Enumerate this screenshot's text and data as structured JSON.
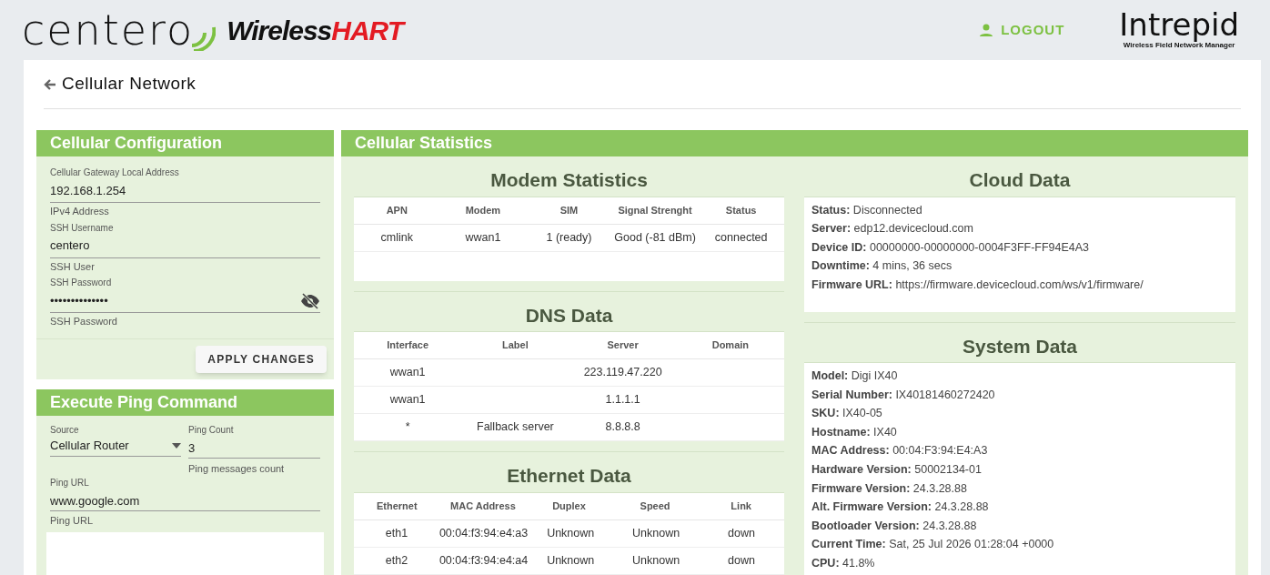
{
  "header": {
    "logo": "centero",
    "brand_left": "Wireless",
    "brand_right": "HART",
    "logout": "LOGOUT",
    "product": "Intrepid",
    "product_subtitle": "Wireless Field Network Manager"
  },
  "page": {
    "title": "Cellular Network"
  },
  "config": {
    "title": "Cellular Configuration",
    "fields": [
      {
        "kind": "text",
        "label": "Cellular Gateway Local Address",
        "value": "192.168.1.254",
        "helper": "IPv4 Address"
      },
      {
        "kind": "text",
        "label": "SSH Username",
        "value": "centero",
        "helper": "SSH User"
      },
      {
        "kind": "password",
        "label": "SSH Password",
        "value": "••••••••••••••",
        "helper": "SSH Password"
      }
    ],
    "button": "APPLY CHANGES"
  },
  "ping": {
    "title": "Execute Ping Command",
    "source": {
      "label": "Source",
      "value": "Cellular Router"
    },
    "count": {
      "label": "Ping Count",
      "value": "3",
      "helper": "Ping messages count"
    },
    "url": {
      "label": "Ping URL",
      "value": "www.google.com",
      "helper": "Ping URL"
    }
  },
  "stats": {
    "title": "Cellular Statistics",
    "tables": [
      {
        "title": "Modem Statistics",
        "columns": [
          "APN",
          "Modem",
          "SIM",
          "Signal Strenght",
          "Status"
        ],
        "rows": [
          [
            "cmlink",
            "wwan1",
            "1 (ready)",
            "Good (-81 dBm)",
            "connected"
          ]
        ]
      },
      {
        "title": "DNS Data",
        "columns": [
          "Interface",
          "Label",
          "Server",
          "Domain"
        ],
        "rows": [
          [
            "wwan1",
            "",
            "223.119.47.220",
            ""
          ],
          [
            "wwan1",
            "",
            "1.1.1.1",
            ""
          ],
          [
            "*",
            "Fallback server",
            "8.8.8.8",
            ""
          ]
        ]
      },
      {
        "title": "Ethernet Data",
        "columns": [
          "Ethernet",
          "MAC Address",
          "Duplex",
          "Speed",
          "Link"
        ],
        "rows": [
          [
            "eth1",
            "00:04:f3:94:e4:a3",
            "Unknown",
            "Unknown",
            "down"
          ],
          [
            "eth2",
            "00:04:f3:94:e4:a4",
            "Unknown",
            "Unknown",
            "down"
          ]
        ]
      }
    ],
    "info": [
      {
        "title": "Cloud Data",
        "items": [
          {
            "label": "Status:",
            "value": "Disconnected"
          },
          {
            "label": "Server:",
            "value": "edp12.devicecloud.com"
          },
          {
            "label": "Device ID:",
            "value": "00000000-00000000-0004F3FF-FF94E4A3"
          },
          {
            "label": "Downtime:",
            "value": "4 mins, 36 secs"
          },
          {
            "label": "Firmware URL:",
            "value": "https://firmware.devicecloud.com/ws/v1/firmware/"
          }
        ]
      },
      {
        "title": "System Data",
        "items": [
          {
            "label": "Model:",
            "value": "Digi IX40"
          },
          {
            "label": "Serial Number:",
            "value": "IX40181460272420"
          },
          {
            "label": "SKU:",
            "value": "IX40-05"
          },
          {
            "label": "Hostname:",
            "value": "IX40"
          },
          {
            "label": "MAC Address:",
            "value": "00:04:F3:94:E4:A3"
          },
          {
            "label": "Hardware Version:",
            "value": "50002134-01"
          },
          {
            "label": "Firmware Version:",
            "value": "24.3.28.88"
          },
          {
            "label": "Alt. Firmware Version:",
            "value": "24.3.28.88"
          },
          {
            "label": "Bootloader Version:",
            "value": "24.3.28.88"
          },
          {
            "label": "Current Time:",
            "value": "Sat, 25 Jul 2026 01:28:04 +0000"
          },
          {
            "label": "CPU:",
            "value": "41.8%"
          }
        ]
      }
    ]
  }
}
